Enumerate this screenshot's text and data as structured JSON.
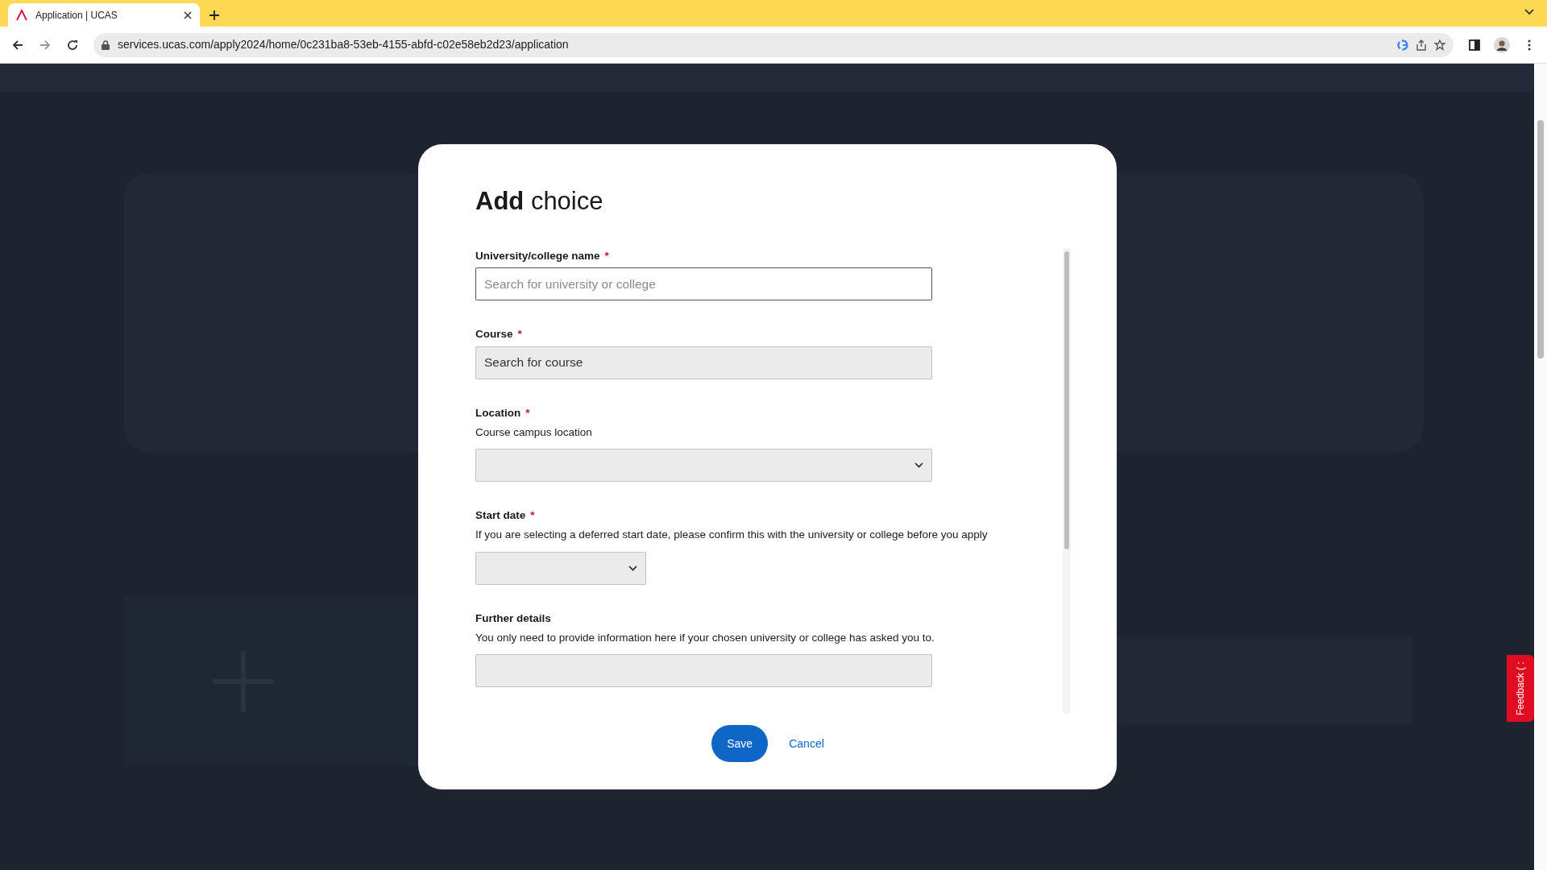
{
  "browser": {
    "tabs": [
      {
        "title": "Application | UCAS",
        "selected": true
      }
    ],
    "url": "services.ucas.com/apply2024/home/0c231ba8-53eb-4155-abfd-c02e58eb2d23/application"
  },
  "dialog": {
    "title": "**Add** choice",
    "fields": [
      {
        "kind": "search",
        "label": "University/college name",
        "required_mark": "*",
        "placeholder": "Search for university or college",
        "disabled": false
      },
      {
        "kind": "search",
        "label": "Course",
        "required_mark": "*",
        "placeholder": "Search for course",
        "disabled": true
      },
      {
        "kind": "select",
        "label": "Location",
        "required_mark": "*",
        "hint": "Course campus location",
        "disabled": true
      },
      {
        "kind": "short-select",
        "label": "Start date",
        "required_mark": "*",
        "hint": "If you are selecting a deferred start date, please confirm this with the university or college before you apply",
        "disabled": true
      },
      {
        "kind": "text",
        "label": "Further details",
        "hint": "You only need to provide information here if your chosen university or college has asked you to.",
        "disabled": true
      }
    ],
    "buttons": [
      {
        "kind": "primary",
        "label": "Save"
      },
      {
        "kind": "link",
        "label": "Cancel"
      }
    ]
  },
  "feedback_tab": {
    "label": "Feedback ( :"
  }
}
